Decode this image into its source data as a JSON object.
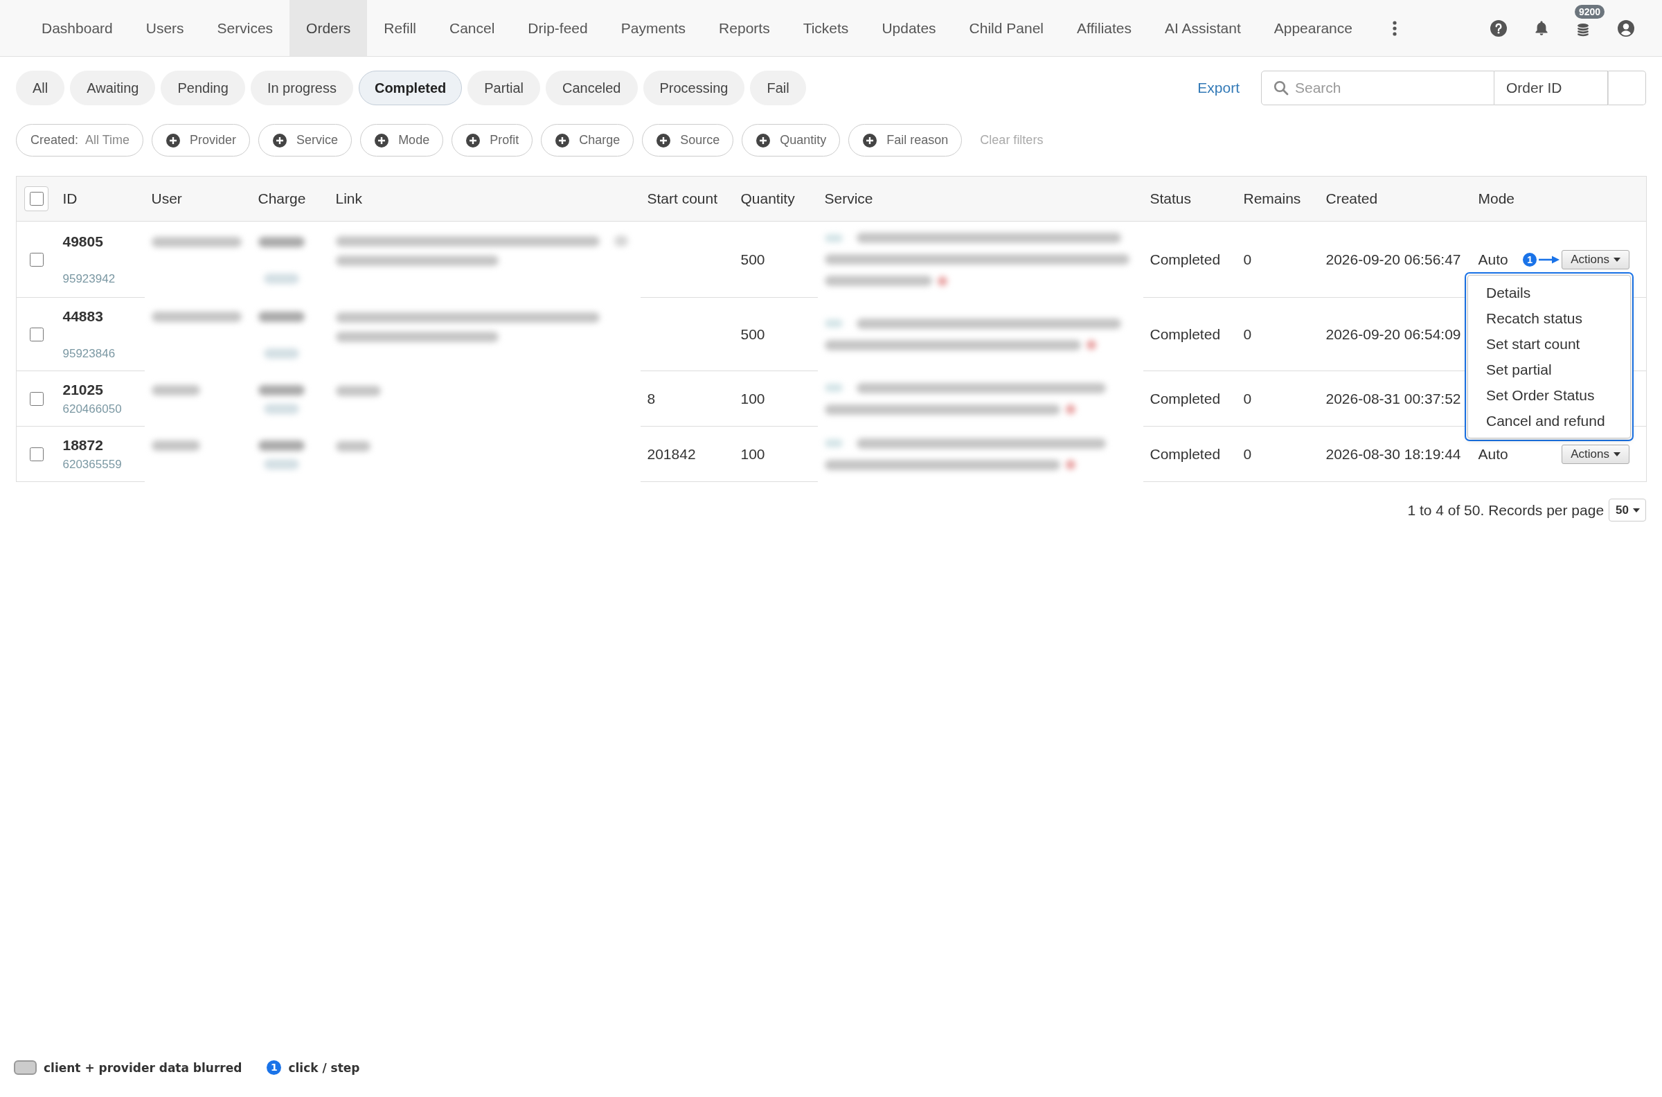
{
  "nav": {
    "items": [
      {
        "label": "Dashboard",
        "selected": false
      },
      {
        "label": "Users",
        "selected": false
      },
      {
        "label": "Services",
        "selected": false
      },
      {
        "label": "Orders",
        "selected": true
      },
      {
        "label": "Refill",
        "selected": false
      },
      {
        "label": "Cancel",
        "selected": false
      },
      {
        "label": "Drip-feed",
        "selected": false
      },
      {
        "label": "Payments",
        "selected": false
      },
      {
        "label": "Reports",
        "selected": false
      },
      {
        "label": "Tickets",
        "selected": false
      },
      {
        "label": "Updates",
        "selected": false
      },
      {
        "label": "Child Panel",
        "selected": false
      },
      {
        "label": "Affiliates",
        "selected": false
      },
      {
        "label": "AI Assistant",
        "selected": false
      },
      {
        "label": "Appearance",
        "selected": false
      }
    ],
    "balance_badge": "9200"
  },
  "status_filters": [
    {
      "label": "All",
      "selected": false
    },
    {
      "label": "Awaiting",
      "selected": false
    },
    {
      "label": "Pending",
      "selected": false
    },
    {
      "label": "In progress",
      "selected": false
    },
    {
      "label": "Completed",
      "selected": true
    },
    {
      "label": "Partial",
      "selected": false
    },
    {
      "label": "Canceled",
      "selected": false
    },
    {
      "label": "Processing",
      "selected": false
    },
    {
      "label": "Fail",
      "selected": false
    }
  ],
  "export_link": "Export",
  "search": {
    "placeholder": "Search",
    "search_by": "Order ID"
  },
  "filter_chips": [
    {
      "kind": "value",
      "label": "Created:",
      "value": "All Time"
    },
    {
      "kind": "add",
      "label": "Provider"
    },
    {
      "kind": "add",
      "label": "Service"
    },
    {
      "kind": "add",
      "label": "Mode"
    },
    {
      "kind": "add",
      "label": "Profit"
    },
    {
      "kind": "add",
      "label": "Charge"
    },
    {
      "kind": "add",
      "label": "Source"
    },
    {
      "kind": "add",
      "label": "Quantity"
    },
    {
      "kind": "add",
      "label": "Fail reason"
    }
  ],
  "clear_filters": "Clear filters",
  "table": {
    "select_all": {
      "checked": false
    },
    "columns": [
      {
        "label": "ID",
        "blurred": false
      },
      {
        "label": "User",
        "blurred": true
      },
      {
        "label": "Charge",
        "blurred": true
      },
      {
        "label": "Link",
        "blurred": true
      },
      {
        "label": "Start count",
        "blurred": false
      },
      {
        "label": "Quantity",
        "blurred": false
      },
      {
        "label": "Service",
        "blurred": true
      },
      {
        "label": "Status",
        "blurred": false
      },
      {
        "label": "Remains",
        "blurred": false
      },
      {
        "label": "Created",
        "blurred": false
      },
      {
        "label": "Mode",
        "blurred": false
      }
    ],
    "rows": [
      {
        "checked": false,
        "id": "49805",
        "reference": "95923942",
        "quantity": "500",
        "status": "Completed",
        "remains": "0",
        "created": "2026-09-20 06:56:47",
        "mode": "Auto",
        "step_marker": "1",
        "actions": "Actions",
        "menu": [
          "Details",
          "Recatch status",
          "Set start count",
          "Set partial",
          "Set Order Status",
          "Cancel and refund"
        ]
      },
      {
        "checked": false,
        "id": "44883",
        "reference": "95923846",
        "quantity": "500",
        "status": "Completed",
        "remains": "0",
        "created": "2026-09-20 06:54:09"
      },
      {
        "checked": false,
        "id": "21025",
        "reference": "620466050",
        "start_count": "8",
        "quantity": "100",
        "status": "Completed",
        "remains": "0",
        "created": "2026-08-31 00:37:52"
      },
      {
        "checked": false,
        "id": "18872",
        "reference": "620365559",
        "start_count": "201842",
        "quantity": "100",
        "status": "Completed",
        "remains": "0",
        "created": "2026-08-30 18:19:44",
        "mode": "Auto",
        "actions": "Actions"
      }
    ]
  },
  "pagination": {
    "summary": "1 to 4 of 50. Records per page",
    "per_page": "50"
  },
  "legend": [
    {
      "kind": "blurred",
      "label": "client + provider data blurred"
    },
    {
      "kind": "step",
      "marker": "1",
      "label": "click / step"
    }
  ]
}
